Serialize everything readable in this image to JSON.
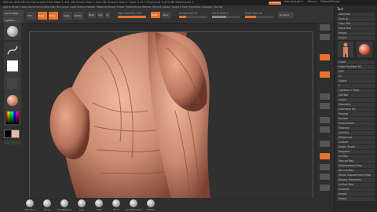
{
  "app": {
    "title_text": "ZBrush 4R6  ZBrush Document  Free Mem 1.421 GB  Active Mem 1.004 GB  Scratch Disk 0  Timer 0.017  PolyCount 9.472 MP  MeshCount 1",
    "menu_row": "Alpha  Brush  Color  Document  Draw  Edit  File  Layer  Light  Macro  Marker  Material  Movie  Picker  Preferences  Render  Stencil  Stroke  Texture  Tool  Transform  Zplugin  Zscript",
    "menus_label": "Menus",
    "quicksave_label": "QuickSave",
    "script_label": "DefaultZScript",
    "see_through": "See-through 0"
  },
  "toolbar": {
    "home_label": "Home Page",
    "lightbox_label": "LightBox",
    "preview_label": "Live Boolean",
    "edit_label": "Edit",
    "draw_label": "Draw",
    "move_label": "Move",
    "scale_label": "Scale",
    "rotate_label": "Rotate",
    "mrgb": "Mrgb",
    "rgb": "Rgb",
    "m": "M",
    "zadd": "Zadd",
    "zsub": "Zsub",
    "focal_shift_label": "Focal Shift 0",
    "draw_size_label": "Draw Size 64",
    "rgb_intensity_label": "Rgb Intensity 100",
    "z_intensity_label": "Z Intensity 25",
    "dynamic_label": "Dynamic"
  },
  "tray": {
    "header": "Tool",
    "items": [
      "Load Tool",
      "Save As",
      "Copy Tool",
      "Paste Tool",
      "Import",
      "Export",
      "Clone",
      "Make PolyMesh3D",
      "GoZ",
      "All",
      "Visible",
      "R",
      "Lightbox > Tools",
      "SubTool",
      "Layers",
      "Geometry",
      "Geometry HD",
      "Preview",
      "Surface",
      "Deformation",
      "Masking",
      "Visibility",
      "Polygroups",
      "Contact",
      "Morph Target",
      "Polypaint",
      "UV Map",
      "Texture Map",
      "Displacement Map",
      "Normal Map",
      "Vector Displacement Map",
      "Display Properties",
      "Unified Skin",
      "Initialize",
      "Import",
      "Export"
    ]
  },
  "bottom_brushes": [
    "Standard",
    "Move",
    "ClayBuildup",
    "Clay",
    "Inflat",
    "Pinch",
    "DamStandard",
    "hPolish",
    "Dam_Standard"
  ],
  "colors": {
    "accent": "#e8712e",
    "skin": "#c98a70",
    "background": "#2b2b2b"
  }
}
